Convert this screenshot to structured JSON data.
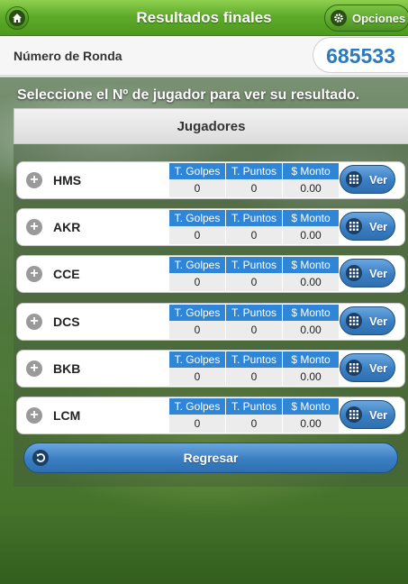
{
  "header": {
    "title": "Resultados finales",
    "options_label": "Opciones"
  },
  "ronda": {
    "label": "Número de Ronda",
    "value": "685533"
  },
  "instructions": "Seleccione el Nº de jugador para ver su resultado.",
  "panel": {
    "title": "Jugadores"
  },
  "columns": {
    "golpes": "T. Golpes",
    "puntos": "T. Puntos",
    "monto": "$ Monto"
  },
  "ver_label": "Ver",
  "players": [
    {
      "name": "HMS",
      "golpes": "0",
      "puntos": "0",
      "monto": "0.00"
    },
    {
      "name": "AKR",
      "golpes": "0",
      "puntos": "0",
      "monto": "0.00"
    },
    {
      "name": "CCE",
      "golpes": "0",
      "puntos": "0",
      "monto": "0.00"
    },
    {
      "name": "DCS",
      "golpes": "0",
      "puntos": "0",
      "monto": "0.00"
    },
    {
      "name": "BKB",
      "golpes": "0",
      "puntos": "0",
      "monto": "0.00"
    },
    {
      "name": "LCM",
      "golpes": "0",
      "puntos": "0",
      "monto": "0.00"
    }
  ],
  "back_label": "Regresar",
  "icons": {
    "home": "home-icon",
    "options": "gear-icon",
    "expand": "plus-icon",
    "view": "grid-icon",
    "back": "back-arrow-icon"
  },
  "colors": {
    "header_green": "#5fab2a",
    "accent_blue": "#2f86d6",
    "ronda_blue": "#2a7ac0"
  }
}
